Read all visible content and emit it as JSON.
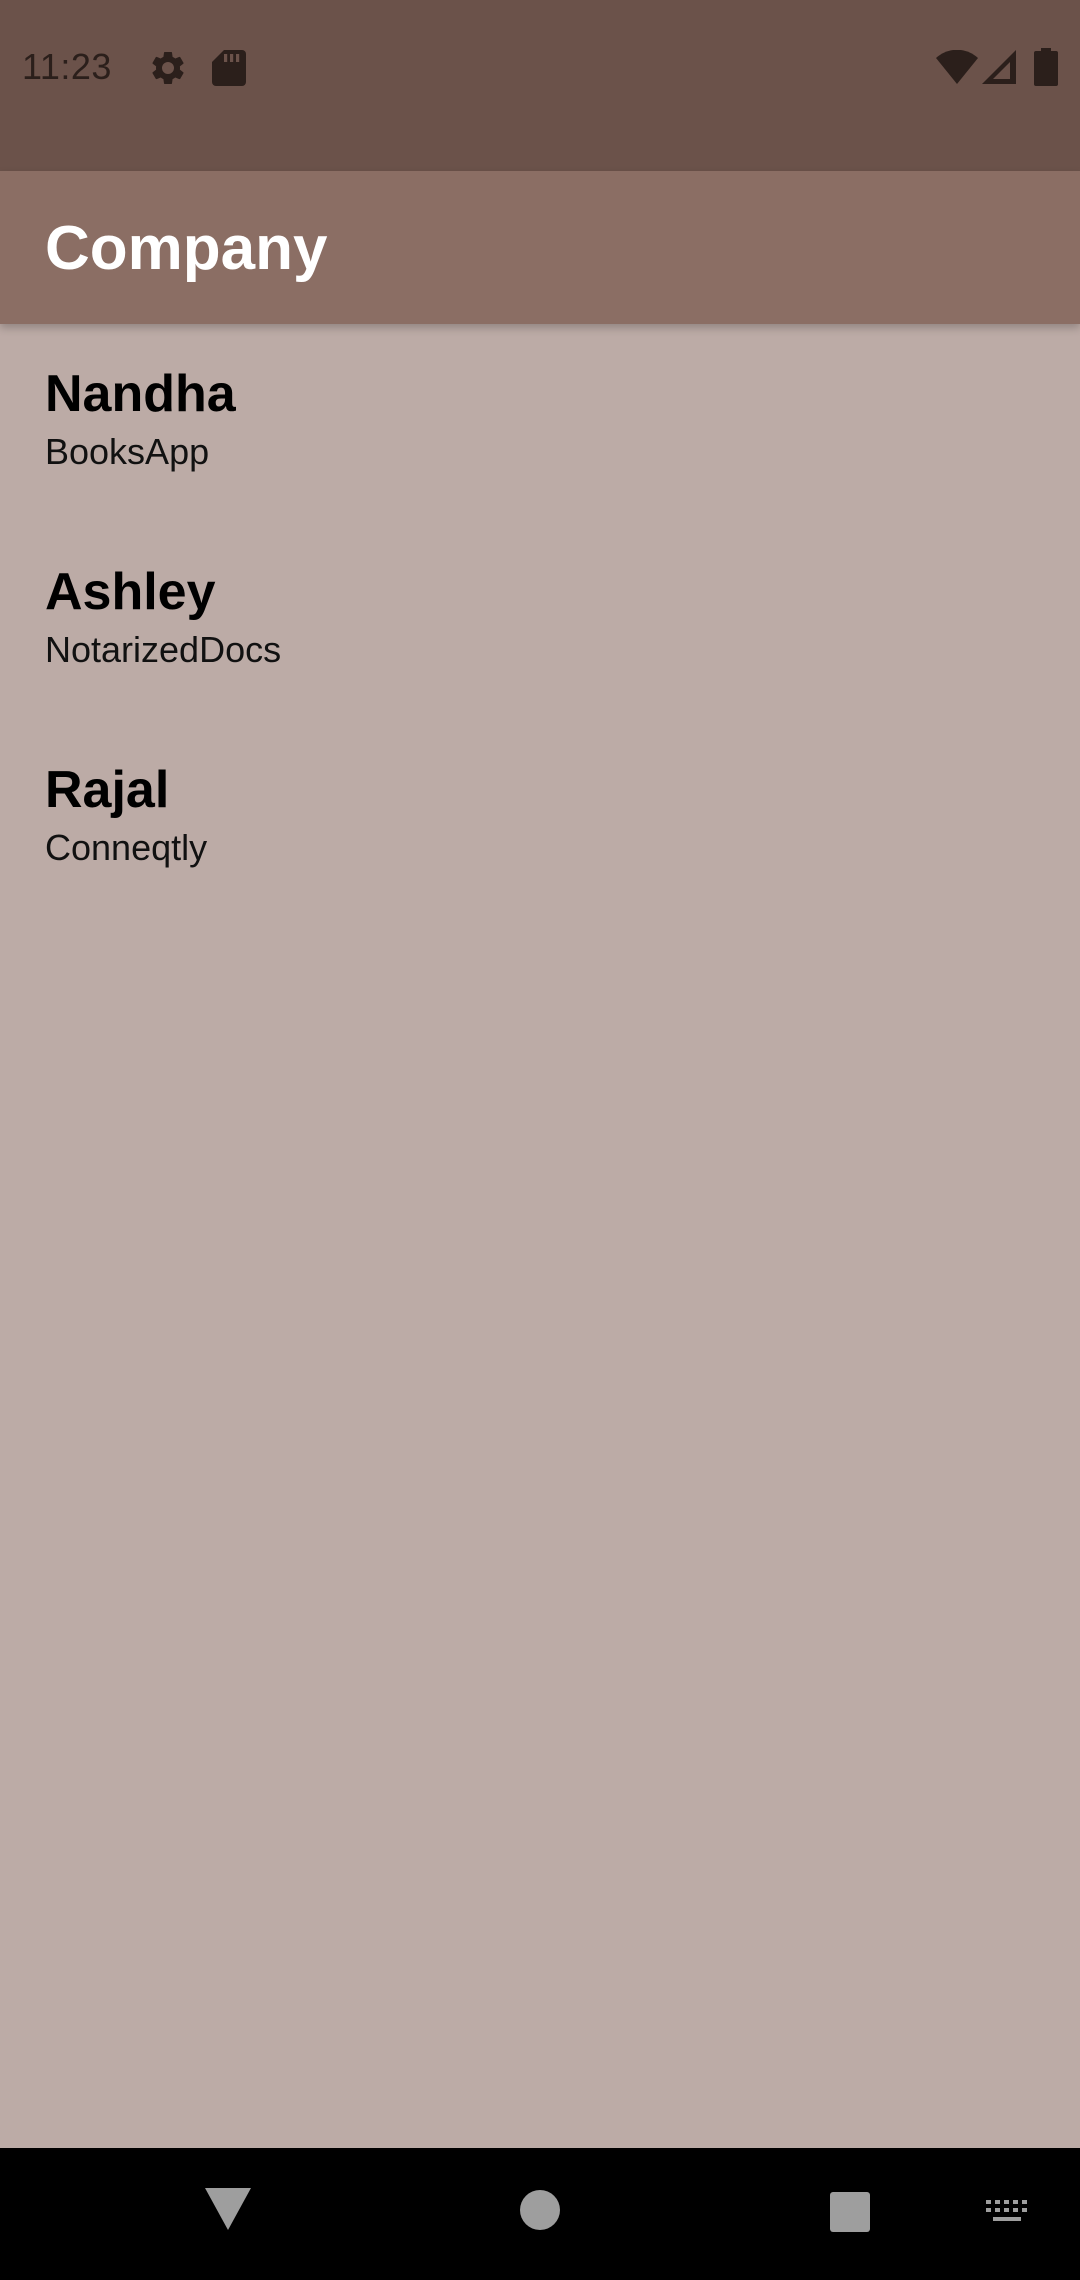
{
  "status_bar": {
    "time": "11:23",
    "icons": [
      "gear-icon",
      "sd-card-icon",
      "wifi-icon",
      "signal-icon",
      "battery-icon"
    ]
  },
  "app_bar": {
    "title": "Company"
  },
  "list": {
    "items": [
      {
        "name": "Nandha",
        "company": "BooksApp"
      },
      {
        "name": "Ashley",
        "company": "NotarizedDocs"
      },
      {
        "name": "Rajal",
        "company": "Conneqtly"
      }
    ]
  },
  "nav_bar": {
    "icons": [
      "back-icon",
      "home-icon",
      "recents-icon",
      "keyboard-icon"
    ]
  },
  "colors": {
    "status_bar_bg": "#6b524a",
    "app_bar_bg": "#8b6e64",
    "content_bg": "#bcaba6",
    "nav_bar_bg": "#000000"
  }
}
